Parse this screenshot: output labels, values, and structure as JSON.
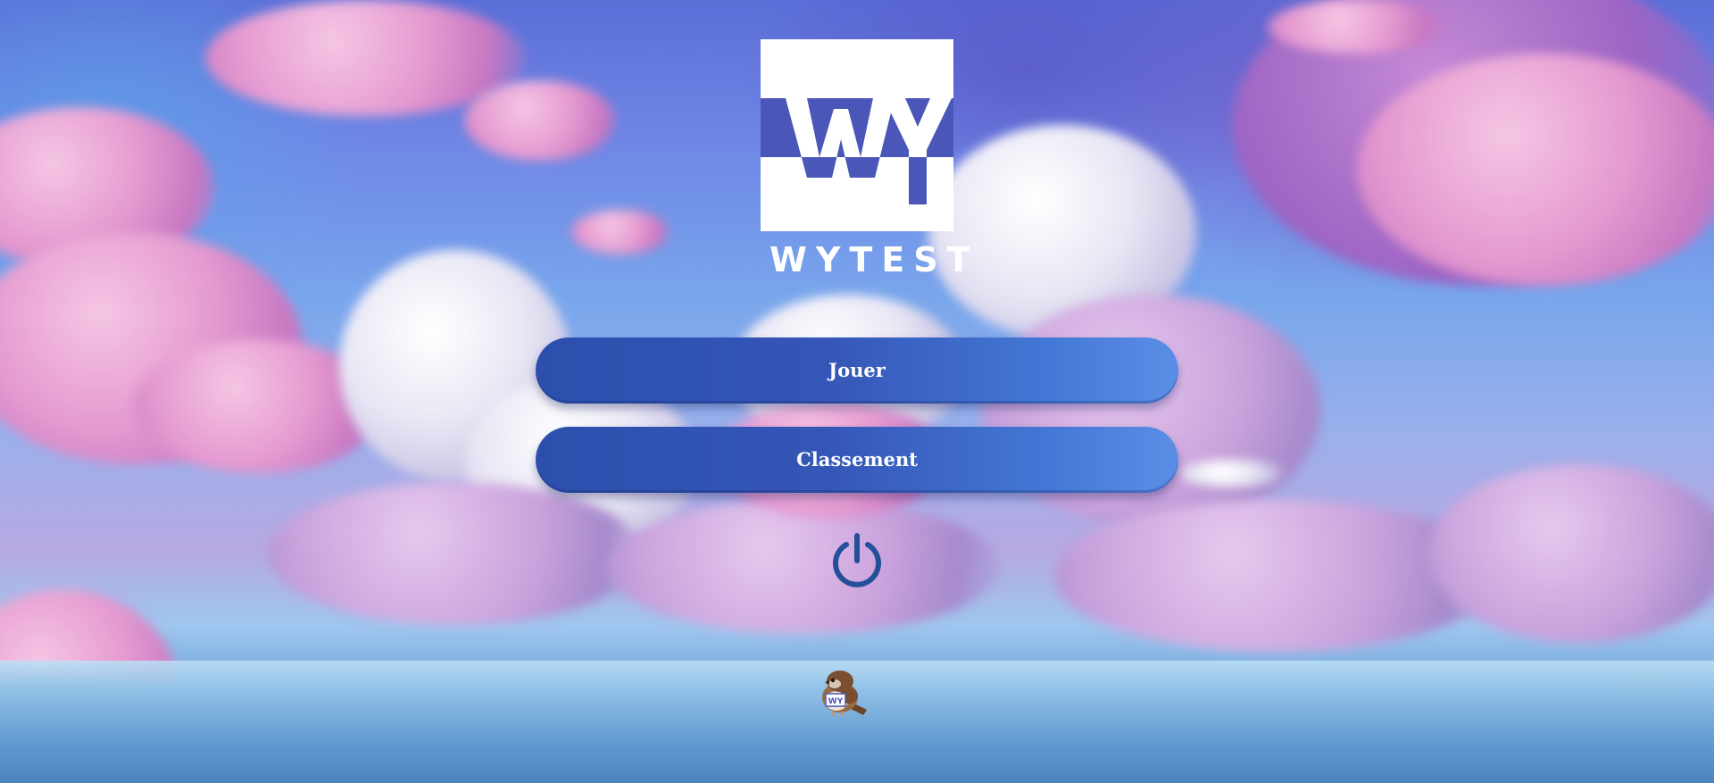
{
  "app": {
    "brand_name": "WYTEST",
    "logo_monogram": "WY"
  },
  "menu": {
    "play_label": "Jouer",
    "leaderboard_label": "Classement",
    "power_icon": "power-icon"
  },
  "mascot": {
    "icon": "sparrow-mascot-icon",
    "badge": "WY"
  },
  "colors": {
    "button_start": "#2c4fae",
    "button_end": "#5a8ee6",
    "logo_band": "#4a56b8",
    "power_icon": "#244f9a",
    "brand_text": "#ffffff"
  }
}
